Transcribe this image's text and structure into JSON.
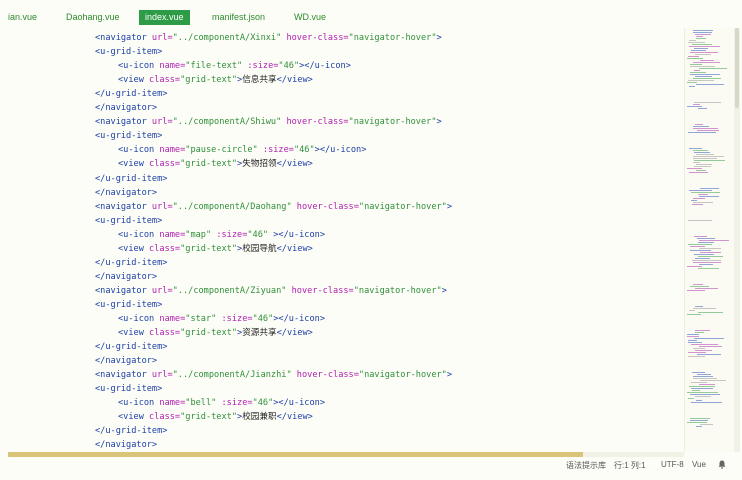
{
  "tabs": [
    {
      "label": "ian.vue",
      "active": false
    },
    {
      "label": "Daohang.vue",
      "active": false
    },
    {
      "label": "index.vue",
      "active": true
    },
    {
      "label": "manifest.json",
      "active": false
    },
    {
      "label": "WD.vue",
      "active": false
    }
  ],
  "code_lines": [
    [
      {
        "t": "tag",
        "v": "<navigator "
      },
      {
        "t": "attr",
        "v": "url="
      },
      {
        "t": "str",
        "v": "\"../componentA/Xinxi\""
      },
      {
        "t": "attr",
        "v": " hover-class="
      },
      {
        "t": "str",
        "v": "\"navigator-hover\""
      },
      {
        "t": "tag",
        "v": ">"
      }
    ],
    [
      {
        "t": "tag",
        "v": "<u-grid-item>"
      }
    ],
    [
      {
        "t": "tag",
        "v": "<u-icon "
      },
      {
        "t": "attr",
        "v": "name="
      },
      {
        "t": "str",
        "v": "\"file-text\""
      },
      {
        "t": "attr",
        "v": " :size="
      },
      {
        "t": "str",
        "v": "\"46\""
      },
      {
        "t": "tag",
        "v": "></u-icon>"
      }
    ],
    [
      {
        "t": "tag",
        "v": "<view "
      },
      {
        "t": "attr",
        "v": "class="
      },
      {
        "t": "str",
        "v": "\"grid-text\""
      },
      {
        "t": "tag",
        "v": ">"
      },
      {
        "t": "text",
        "v": "信息共享"
      },
      {
        "t": "tag",
        "v": "</view>"
      }
    ],
    [
      {
        "t": "tag",
        "v": "</u-grid-item>"
      }
    ],
    [
      {
        "t": "tag",
        "v": "</navigator>"
      }
    ],
    [
      {
        "t": "tag",
        "v": "<navigator "
      },
      {
        "t": "attr",
        "v": "url="
      },
      {
        "t": "str",
        "v": "\"../componentA/Shiwu\""
      },
      {
        "t": "attr",
        "v": " hover-class="
      },
      {
        "t": "str",
        "v": "\"navigator-hover\""
      },
      {
        "t": "tag",
        "v": ">"
      }
    ],
    [
      {
        "t": "tag",
        "v": "<u-grid-item>"
      }
    ],
    [
      {
        "t": "tag",
        "v": "<u-icon "
      },
      {
        "t": "attr",
        "v": "name="
      },
      {
        "t": "str",
        "v": "\"pause-circle\""
      },
      {
        "t": "attr",
        "v": " :size="
      },
      {
        "t": "str",
        "v": "\"46\""
      },
      {
        "t": "tag",
        "v": "></u-icon>"
      }
    ],
    [
      {
        "t": "tag",
        "v": "<view "
      },
      {
        "t": "attr",
        "v": "class="
      },
      {
        "t": "str",
        "v": "\"grid-text\""
      },
      {
        "t": "tag",
        "v": ">"
      },
      {
        "t": "text",
        "v": "失物招领"
      },
      {
        "t": "tag",
        "v": "</view>"
      }
    ],
    [
      {
        "t": "tag",
        "v": "</u-grid-item>"
      }
    ],
    [
      {
        "t": "tag",
        "v": "</navigator>"
      }
    ],
    [
      {
        "t": "tag",
        "v": "<navigator "
      },
      {
        "t": "attr",
        "v": "url="
      },
      {
        "t": "str",
        "v": "\"../componentA/Daohang\""
      },
      {
        "t": "attr",
        "v": " hover-class="
      },
      {
        "t": "str",
        "v": "\"navigator-hover\""
      },
      {
        "t": "tag",
        "v": ">"
      }
    ],
    [
      {
        "t": "tag",
        "v": "<u-grid-item>"
      }
    ],
    [
      {
        "t": "tag",
        "v": "<u-icon "
      },
      {
        "t": "attr",
        "v": "name="
      },
      {
        "t": "str",
        "v": "\"map\""
      },
      {
        "t": "attr",
        "v": " :size="
      },
      {
        "t": "str",
        "v": "\"46\""
      },
      {
        "t": "tag",
        "v": " ></u-icon>"
      }
    ],
    [
      {
        "t": "tag",
        "v": "<view "
      },
      {
        "t": "attr",
        "v": "class="
      },
      {
        "t": "str",
        "v": "\"grid-text\""
      },
      {
        "t": "tag",
        "v": ">"
      },
      {
        "t": "text",
        "v": "校园导航"
      },
      {
        "t": "tag",
        "v": "</view>"
      }
    ],
    [
      {
        "t": "tag",
        "v": "</u-grid-item>"
      }
    ],
    [
      {
        "t": "tag",
        "v": "</navigator>"
      }
    ],
    [
      {
        "t": "tag",
        "v": "<navigator "
      },
      {
        "t": "attr",
        "v": "url="
      },
      {
        "t": "str",
        "v": "\"../componentA/Ziyuan\""
      },
      {
        "t": "attr",
        "v": " hover-class="
      },
      {
        "t": "str",
        "v": "\"navigator-hover\""
      },
      {
        "t": "tag",
        "v": ">"
      }
    ],
    [
      {
        "t": "tag",
        "v": "<u-grid-item>"
      }
    ],
    [
      {
        "t": "tag",
        "v": "<u-icon "
      },
      {
        "t": "attr",
        "v": "name="
      },
      {
        "t": "str",
        "v": "\"star\""
      },
      {
        "t": "attr",
        "v": " :size="
      },
      {
        "t": "str",
        "v": "\"46\""
      },
      {
        "t": "tag",
        "v": "></u-icon>"
      }
    ],
    [
      {
        "t": "tag",
        "v": "<view "
      },
      {
        "t": "attr",
        "v": "class="
      },
      {
        "t": "str",
        "v": "\"grid-text\""
      },
      {
        "t": "tag",
        "v": ">"
      },
      {
        "t": "text",
        "v": "资源共享"
      },
      {
        "t": "tag",
        "v": "</view>"
      }
    ],
    [
      {
        "t": "tag",
        "v": "</u-grid-item>"
      }
    ],
    [
      {
        "t": "tag",
        "v": "</navigator>"
      }
    ],
    [
      {
        "t": "tag",
        "v": "<navigator "
      },
      {
        "t": "attr",
        "v": "url="
      },
      {
        "t": "str",
        "v": "\"../componentA/Jianzhi\""
      },
      {
        "t": "attr",
        "v": " hover-class="
      },
      {
        "t": "str",
        "v": "\"navigator-hover\""
      },
      {
        "t": "tag",
        "v": ">"
      }
    ],
    [
      {
        "t": "tag",
        "v": "<u-grid-item>"
      }
    ],
    [
      {
        "t": "tag",
        "v": "<u-icon "
      },
      {
        "t": "attr",
        "v": "name="
      },
      {
        "t": "str",
        "v": "\"bell\""
      },
      {
        "t": "attr",
        "v": " :size="
      },
      {
        "t": "str",
        "v": "\"46\""
      },
      {
        "t": "tag",
        "v": "></u-icon>"
      }
    ],
    [
      {
        "t": "tag",
        "v": "<view "
      },
      {
        "t": "attr",
        "v": "class="
      },
      {
        "t": "str",
        "v": "\"grid-text\""
      },
      {
        "t": "tag",
        "v": ">"
      },
      {
        "t": "text",
        "v": "校园兼职"
      },
      {
        "t": "tag",
        "v": "</view>"
      }
    ],
    [
      {
        "t": "tag",
        "v": "</u-grid-item>"
      }
    ],
    [
      {
        "t": "tag",
        "v": "</navigator>"
      }
    ]
  ],
  "statusbar": {
    "hint": "语法提示库",
    "position": "行:1  列:1",
    "encoding": "UTF-8",
    "language": "Vue",
    "bell_icon": "bell-icon"
  },
  "colors": {
    "tag": "#1a3fa6",
    "attr": "#b020b0",
    "string": "#2f8f3a",
    "active_tab": "#2e9b46"
  }
}
